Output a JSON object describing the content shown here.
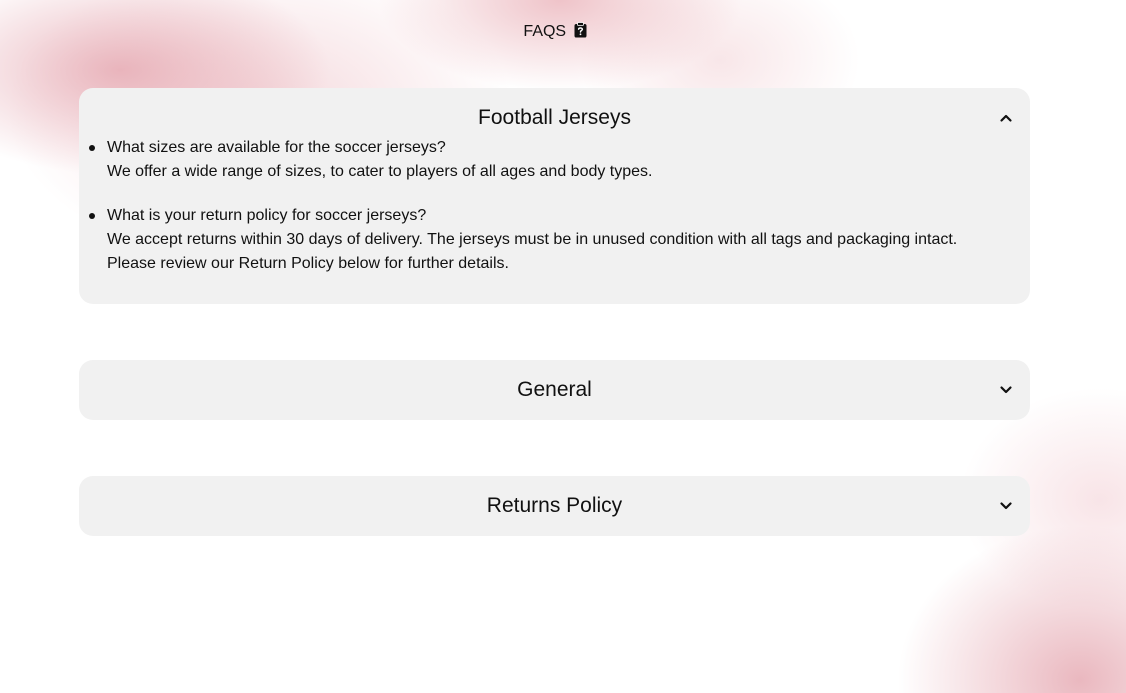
{
  "header": {
    "title": "FAQS"
  },
  "sections": [
    {
      "title": "Football Jerseys",
      "expanded": true,
      "items": [
        {
          "question": "What sizes are available for the soccer jerseys?",
          "answer_lines": [
            "We offer a wide range of sizes, to cater to players of all ages and body types."
          ]
        },
        {
          "question": "What is your return policy for soccer jerseys?",
          "answer_lines": [
            "We accept returns within 30 days of delivery. The jerseys must be in unused condition with all tags and packaging intact.",
            "Please review our Return Policy below for further details."
          ]
        }
      ]
    },
    {
      "title": "General",
      "expanded": false
    },
    {
      "title": "Returns Policy",
      "expanded": false
    }
  ],
  "icons": {
    "header": "clipboard-question-icon",
    "expanded": "chevron-up-icon",
    "collapsed": "chevron-down-icon"
  },
  "colors": {
    "card_bg": "#f1f1f1",
    "text": "#111111",
    "accent_blush": "#e3a0aa"
  }
}
